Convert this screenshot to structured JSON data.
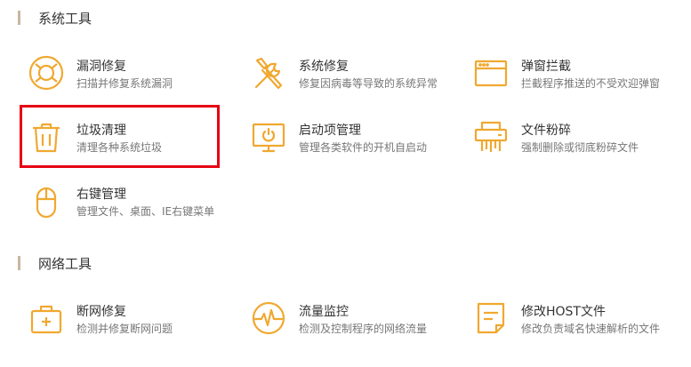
{
  "sections": {
    "system": "系统工具",
    "network": "网络工具"
  },
  "accent_color": "#f0a830",
  "highlight_color": "#e60012",
  "tools": {
    "vuln_repair": {
      "title": "漏洞修复",
      "desc": "扫描并修复系统漏洞",
      "icon": "lifebuoy-icon"
    },
    "system_repair": {
      "title": "系统修复",
      "desc": "修复因病毒等导致的系统异常",
      "icon": "wrench-screwdriver-icon"
    },
    "popup_block": {
      "title": "弹窗拦截",
      "desc": "拦截程序推送的不受欢迎弹窗",
      "icon": "window-icon"
    },
    "junk_clean": {
      "title": "垃圾清理",
      "desc": "清理各种系统垃圾",
      "icon": "trash-icon"
    },
    "startup_manage": {
      "title": "启动项管理",
      "desc": "管理各类软件的开机自启动",
      "icon": "monitor-power-icon"
    },
    "file_shred": {
      "title": "文件粉碎",
      "desc": "强制删除或彻底粉碎文件",
      "icon": "shredder-icon"
    },
    "context_menu": {
      "title": "右键管理",
      "desc": "管理文件、桌面、IE右键菜单",
      "icon": "mouse-icon"
    },
    "network_repair": {
      "title": "断网修复",
      "desc": "检测并修复断网问题",
      "icon": "first-aid-kit-icon"
    },
    "traffic_monitor": {
      "title": "流量监控",
      "desc": "检测及控制程序的网络流量",
      "icon": "pulse-icon"
    },
    "host_edit": {
      "title": "修改HOST文件",
      "desc": "修改负责域名快速解析的文件",
      "icon": "document-icon"
    }
  }
}
